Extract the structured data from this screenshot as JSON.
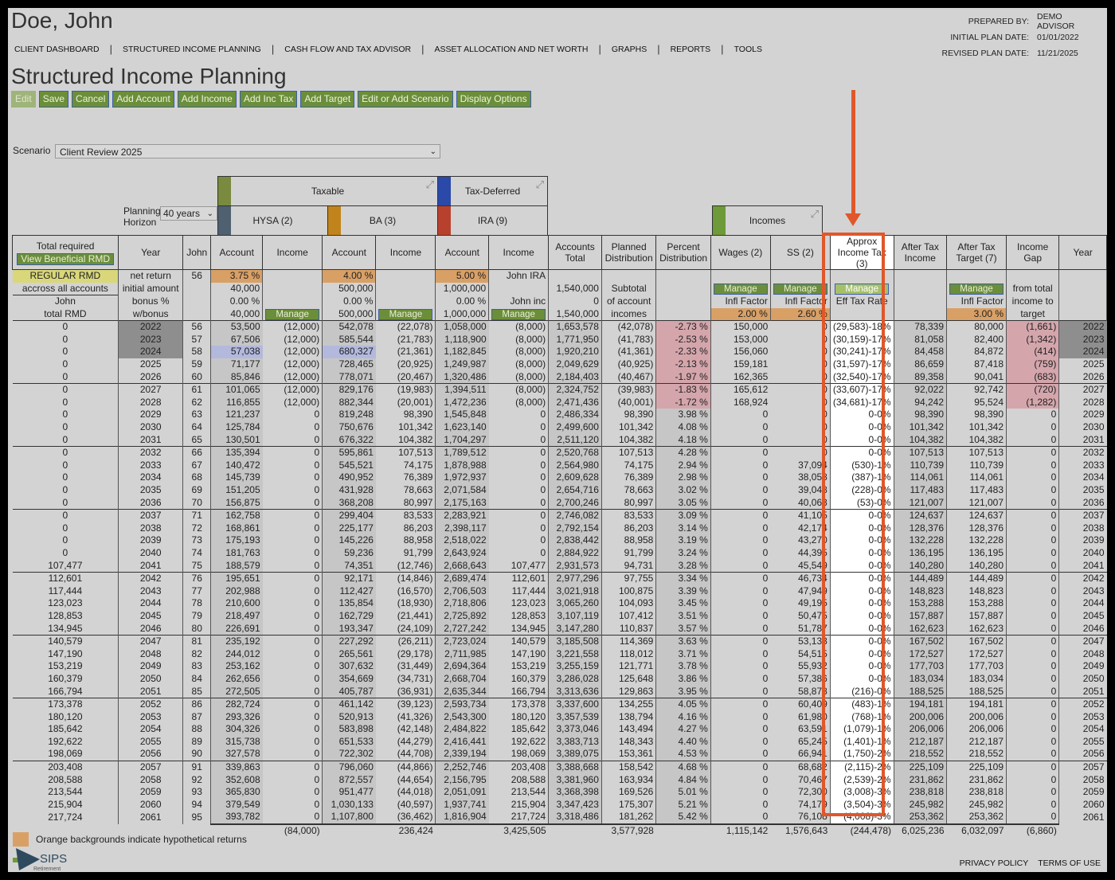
{
  "client_name": "Doe, John",
  "nav": [
    "CLIENT DASHBOARD",
    "STRUCTURED INCOME PLANNING",
    "CASH FLOW AND TAX ADVISOR",
    "ASSET ALLOCATION AND NET WORTH",
    "GRAPHS",
    "REPORTS",
    "TOOLS"
  ],
  "plan_info": {
    "prepared_by_label": "PREPARED BY:",
    "prepared_by": "DEMO ADVISOR",
    "initial_label": "INITIAL PLAN DATE:",
    "initial": "01/01/2022",
    "revised_label": "REVISED PLAN DATE:",
    "revised": "11/21/2025"
  },
  "page_title": "Structured Income Planning",
  "toolbar": [
    "Edit",
    "Save",
    "Cancel",
    "Add Account",
    "Add Income",
    "Add Inc Tax",
    "Add Target",
    "Edit or Add Scenario",
    "Display Options"
  ],
  "scenario": {
    "label": "Scenario",
    "value": "Client Review 2025"
  },
  "planning_horizon": {
    "label": "Planning Horizon",
    "value": "40 years"
  },
  "groups": {
    "taxable": "Taxable",
    "tax_deferred": "Tax-Deferred",
    "hysa": "HYSA (2)",
    "ba": "BA (3)",
    "ira": "IRA (9)",
    "incomes": "Incomes"
  },
  "colors": {
    "taxable": "#7a8a3e",
    "tax_deferred": "#2a49a8",
    "hysa": "#4f6070",
    "ba": "#c1841c",
    "ira": "#b8412e",
    "incomes": "#6e9a3a",
    "hypothetical": "#d9a066",
    "highlight": "#e0572a"
  },
  "table": {
    "total_required": "Total required",
    "view_rmd_button": "View Beneficial RMD",
    "columns": [
      "",
      "Year",
      "John",
      "Account",
      "Income",
      "Account",
      "Income",
      "Account",
      "Income",
      "Accounts Total",
      "Planned Distribution",
      "Percent Distribution",
      "Wages (2)",
      "SS (2)",
      "Approx Income Tax (3)",
      "After Tax Income",
      "After Tax Target (7)",
      "Income Gap",
      "Year"
    ],
    "sub_rows": [
      [
        "REGULAR RMD",
        "net return",
        "56",
        "3.75 %",
        "",
        "4.00 %",
        "",
        "5.00 %",
        "John IRA",
        "",
        "",
        "",
        "",
        "",
        "",
        "",
        "",
        "",
        ""
      ],
      [
        "accross all accounts",
        "initial amount",
        "",
        "40,000",
        "",
        "500,000",
        "",
        "1,000,000",
        "",
        "1,540,000",
        "Subtotal",
        "",
        {
          "button": "Manage"
        },
        {
          "button": "Manage"
        },
        {
          "button": "Manage"
        },
        "",
        {
          "button": "Manage"
        },
        "from total",
        ""
      ],
      [
        "John",
        "bonus %",
        "",
        "0.00 %",
        "",
        "0.00 %",
        "",
        "0.00 %",
        "John inc",
        "0",
        "of account",
        "",
        "Infl Factor",
        "Infl Factor",
        "Eff Tax Rate",
        "",
        "Infl Factor",
        "income to",
        ""
      ],
      [
        "total RMD",
        "w/bonus",
        "",
        "40,000",
        {
          "button": "Manage"
        },
        "500,000",
        {
          "button": "Manage"
        },
        "1,000,000",
        {
          "button": "Manage"
        },
        "1,540,000",
        "incomes",
        "",
        "2.00 %",
        "2.60 %",
        "",
        "",
        "3.00 %",
        "target",
        ""
      ]
    ],
    "rows": [
      [
        "0",
        "2022",
        "56",
        "53,500",
        "(12,000)",
        "542,078",
        "(22,078)",
        "1,058,000",
        "(8,000)",
        "1,653,578",
        "(42,078)",
        "-2.73 %",
        "150,000",
        "0",
        "(29,583)-18%",
        "78,339",
        "80,000",
        "(1,661)",
        "2022"
      ],
      [
        "0",
        "2023",
        "57",
        "67,506",
        "(12,000)",
        "585,544",
        "(21,783)",
        "1,118,900",
        "(8,000)",
        "1,771,950",
        "(41,783)",
        "-2.53 %",
        "153,000",
        "0",
        "(30,159)-17%",
        "81,058",
        "82,400",
        "(1,342)",
        "2023"
      ],
      [
        "0",
        "2024",
        "58",
        "57,038",
        "(12,000)",
        "680,327",
        "(21,361)",
        "1,182,845",
        "(8,000)",
        "1,920,210",
        "(41,361)",
        "-2.33 %",
        "156,060",
        "0",
        "(30,241)-17%",
        "84,458",
        "84,872",
        "(414)",
        "2024"
      ],
      [
        "0",
        "2025",
        "59",
        "71,177",
        "(12,000)",
        "728,465",
        "(20,925)",
        "1,249,987",
        "(8,000)",
        "2,049,629",
        "(40,925)",
        "-2.13 %",
        "159,181",
        "0",
        "(31,597)-17%",
        "86,659",
        "87,418",
        "(759)",
        "2025"
      ],
      [
        "0",
        "2026",
        "60",
        "85,846",
        "(12,000)",
        "778,071",
        "(20,467)",
        "1,320,486",
        "(8,000)",
        "2,184,403",
        "(40,467)",
        "-1.97 %",
        "162,365",
        "0",
        "(32,540)-17%",
        "89,358",
        "90,041",
        "(683)",
        "2026"
      ],
      [
        "0",
        "2027",
        "61",
        "101,065",
        "(12,000)",
        "829,176",
        "(19,983)",
        "1,394,511",
        "(8,000)",
        "2,324,752",
        "(39,983)",
        "-1.83 %",
        "165,612",
        "0",
        "(33,607)-17%",
        "92,022",
        "92,742",
        "(720)",
        "2027"
      ],
      [
        "0",
        "2028",
        "62",
        "116,855",
        "(12,000)",
        "882,344",
        "(20,001)",
        "1,472,236",
        "(8,000)",
        "2,471,436",
        "(40,001)",
        "-1.72 %",
        "168,924",
        "0",
        "(34,681)-17%",
        "94,242",
        "95,524",
        "(1,282)",
        "2028"
      ],
      [
        "0",
        "2029",
        "63",
        "121,237",
        "0",
        "819,248",
        "98,390",
        "1,545,848",
        "0",
        "2,486,334",
        "98,390",
        "3.98 %",
        "0",
        "0",
        "0-0%",
        "98,390",
        "98,390",
        "0",
        "2029"
      ],
      [
        "0",
        "2030",
        "64",
        "125,784",
        "0",
        "750,676",
        "101,342",
        "1,623,140",
        "0",
        "2,499,600",
        "101,342",
        "4.08 %",
        "0",
        "0",
        "0-0%",
        "101,342",
        "101,342",
        "0",
        "2030"
      ],
      [
        "0",
        "2031",
        "65",
        "130,501",
        "0",
        "676,322",
        "104,382",
        "1,704,297",
        "0",
        "2,511,120",
        "104,382",
        "4.18 %",
        "0",
        "0",
        "0-0%",
        "104,382",
        "104,382",
        "0",
        "2031"
      ],
      [
        "0",
        "2032",
        "66",
        "135,394",
        "0",
        "595,861",
        "107,513",
        "1,789,512",
        "0",
        "2,520,768",
        "107,513",
        "4.28 %",
        "0",
        "0",
        "0-0%",
        "107,513",
        "107,513",
        "0",
        "2032"
      ],
      [
        "0",
        "2033",
        "67",
        "140,472",
        "0",
        "545,521",
        "74,175",
        "1,878,988",
        "0",
        "2,564,980",
        "74,175",
        "2.94 %",
        "0",
        "37,094",
        "(530)-1%",
        "110,739",
        "110,739",
        "0",
        "2033"
      ],
      [
        "0",
        "2034",
        "68",
        "145,739",
        "0",
        "490,952",
        "76,389",
        "1,972,937",
        "0",
        "2,609,628",
        "76,389",
        "2.98 %",
        "0",
        "38,058",
        "(387)-1%",
        "114,061",
        "114,061",
        "0",
        "2034"
      ],
      [
        "0",
        "2035",
        "69",
        "151,205",
        "0",
        "431,928",
        "78,663",
        "2,071,584",
        "0",
        "2,654,716",
        "78,663",
        "3.02 %",
        "0",
        "39,048",
        "(228)-0%",
        "117,483",
        "117,483",
        "0",
        "2035"
      ],
      [
        "0",
        "2036",
        "70",
        "156,875",
        "0",
        "368,208",
        "80,997",
        "2,175,163",
        "0",
        "2,700,246",
        "80,997",
        "3.05 %",
        "0",
        "40,063",
        "(53)-0%",
        "121,007",
        "121,007",
        "0",
        "2036"
      ],
      [
        "0",
        "2037",
        "71",
        "162,758",
        "0",
        "299,404",
        "83,533",
        "2,283,921",
        "0",
        "2,746,082",
        "83,533",
        "3.09 %",
        "0",
        "41,105",
        "0-0%",
        "124,637",
        "124,637",
        "0",
        "2037"
      ],
      [
        "0",
        "2038",
        "72",
        "168,861",
        "0",
        "225,177",
        "86,203",
        "2,398,117",
        "0",
        "2,792,154",
        "86,203",
        "3.14 %",
        "0",
        "42,174",
        "0-0%",
        "128,376",
        "128,376",
        "0",
        "2038"
      ],
      [
        "0",
        "2039",
        "73",
        "175,193",
        "0",
        "145,226",
        "88,958",
        "2,518,022",
        "0",
        "2,838,442",
        "88,958",
        "3.19 %",
        "0",
        "43,270",
        "0-0%",
        "132,228",
        "132,228",
        "0",
        "2039"
      ],
      [
        "0",
        "2040",
        "74",
        "181,763",
        "0",
        "59,236",
        "91,799",
        "2,643,924",
        "0",
        "2,884,922",
        "91,799",
        "3.24 %",
        "0",
        "44,395",
        "0-0%",
        "136,195",
        "136,195",
        "0",
        "2040"
      ],
      [
        "107,477",
        "2041",
        "75",
        "188,579",
        "0",
        "74,351",
        "(12,746)",
        "2,668,643",
        "107,477",
        "2,931,573",
        "94,731",
        "3.28 %",
        "0",
        "45,549",
        "0-0%",
        "140,280",
        "140,280",
        "0",
        "2041"
      ],
      [
        "112,601",
        "2042",
        "76",
        "195,651",
        "0",
        "92,171",
        "(14,846)",
        "2,689,474",
        "112,601",
        "2,977,296",
        "97,755",
        "3.34 %",
        "0",
        "46,734",
        "0-0%",
        "144,489",
        "144,489",
        "0",
        "2042"
      ],
      [
        "117,444",
        "2043",
        "77",
        "202,988",
        "0",
        "112,427",
        "(16,570)",
        "2,706,503",
        "117,444",
        "3,021,918",
        "100,875",
        "3.39 %",
        "0",
        "47,949",
        "0-0%",
        "148,823",
        "148,823",
        "0",
        "2043"
      ],
      [
        "123,023",
        "2044",
        "78",
        "210,600",
        "0",
        "135,854",
        "(18,930)",
        "2,718,806",
        "123,023",
        "3,065,260",
        "104,093",
        "3.45 %",
        "0",
        "49,195",
        "0-0%",
        "153,288",
        "153,288",
        "0",
        "2044"
      ],
      [
        "128,853",
        "2045",
        "79",
        "218,497",
        "0",
        "162,729",
        "(21,441)",
        "2,725,892",
        "128,853",
        "3,107,119",
        "107,412",
        "3.51 %",
        "0",
        "50,475",
        "0-0%",
        "157,887",
        "157,887",
        "0",
        "2045"
      ],
      [
        "134,945",
        "2046",
        "80",
        "226,691",
        "0",
        "193,347",
        "(24,109)",
        "2,727,242",
        "134,945",
        "3,147,280",
        "110,837",
        "3.57 %",
        "0",
        "51,787",
        "0-0%",
        "162,623",
        "162,623",
        "0",
        "2046"
      ],
      [
        "140,579",
        "2047",
        "81",
        "235,192",
        "0",
        "227,292",
        "(26,211)",
        "2,723,024",
        "140,579",
        "3,185,508",
        "114,369",
        "3.63 %",
        "0",
        "53,133",
        "0-0%",
        "167,502",
        "167,502",
        "0",
        "2047"
      ],
      [
        "147,190",
        "2048",
        "82",
        "244,012",
        "0",
        "265,561",
        "(29,178)",
        "2,711,985",
        "147,190",
        "3,221,558",
        "118,012",
        "3.71 %",
        "0",
        "54,515",
        "0-0%",
        "172,527",
        "172,527",
        "0",
        "2048"
      ],
      [
        "153,219",
        "2049",
        "83",
        "253,162",
        "0",
        "307,632",
        "(31,449)",
        "2,694,364",
        "153,219",
        "3,255,159",
        "121,771",
        "3.78 %",
        "0",
        "55,932",
        "0-0%",
        "177,703",
        "177,703",
        "0",
        "2049"
      ],
      [
        "160,379",
        "2050",
        "84",
        "262,656",
        "0",
        "354,669",
        "(34,731)",
        "2,668,704",
        "160,379",
        "3,286,028",
        "125,648",
        "3.86 %",
        "0",
        "57,386",
        "0-0%",
        "183,034",
        "183,034",
        "0",
        "2050"
      ],
      [
        "166,794",
        "2051",
        "85",
        "272,505",
        "0",
        "405,787",
        "(36,931)",
        "2,635,344",
        "166,794",
        "3,313,636",
        "129,863",
        "3.95 %",
        "0",
        "58,878",
        "(216)-0%",
        "188,525",
        "188,525",
        "0",
        "2051"
      ],
      [
        "173,378",
        "2052",
        "86",
        "282,724",
        "0",
        "461,142",
        "(39,123)",
        "2,593,734",
        "173,378",
        "3,337,600",
        "134,255",
        "4.05 %",
        "0",
        "60,409",
        "(483)-1%",
        "194,181",
        "194,181",
        "0",
        "2052"
      ],
      [
        "180,120",
        "2053",
        "87",
        "293,326",
        "0",
        "520,913",
        "(41,326)",
        "2,543,300",
        "180,120",
        "3,357,539",
        "138,794",
        "4.16 %",
        "0",
        "61,980",
        "(768)-1%",
        "200,006",
        "200,006",
        "0",
        "2053"
      ],
      [
        "185,642",
        "2054",
        "88",
        "304,326",
        "0",
        "583,898",
        "(42,148)",
        "2,484,822",
        "185,642",
        "3,373,046",
        "143,494",
        "4.27 %",
        "0",
        "63,591",
        "(1,079)-1%",
        "206,006",
        "206,006",
        "0",
        "2054"
      ],
      [
        "192,622",
        "2055",
        "89",
        "315,738",
        "0",
        "651,533",
        "(44,279)",
        "2,416,441",
        "192,622",
        "3,383,713",
        "148,343",
        "4.40 %",
        "0",
        "65,245",
        "(1,401)-1%",
        "212,187",
        "212,187",
        "0",
        "2055"
      ],
      [
        "198,069",
        "2056",
        "90",
        "327,578",
        "0",
        "722,302",
        "(44,708)",
        "2,339,194",
        "198,069",
        "3,389,075",
        "153,361",
        "4.53 %",
        "0",
        "66,941",
        "(1,750)-2%",
        "218,552",
        "218,552",
        "0",
        "2056"
      ],
      [
        "203,408",
        "2057",
        "91",
        "339,863",
        "0",
        "796,060",
        "(44,866)",
        "2,252,746",
        "203,408",
        "3,388,668",
        "158,542",
        "4.68 %",
        "0",
        "68,682",
        "(2,115)-2%",
        "225,109",
        "225,109",
        "0",
        "2057"
      ],
      [
        "208,588",
        "2058",
        "92",
        "352,608",
        "0",
        "872,557",
        "(44,654)",
        "2,156,795",
        "208,588",
        "3,381,960",
        "163,934",
        "4.84 %",
        "0",
        "70,467",
        "(2,539)-2%",
        "231,862",
        "231,862",
        "0",
        "2058"
      ],
      [
        "213,544",
        "2059",
        "93",
        "365,830",
        "0",
        "951,477",
        "(44,018)",
        "2,051,091",
        "213,544",
        "3,368,398",
        "169,526",
        "5.01 %",
        "0",
        "72,300",
        "(3,008)-3%",
        "238,818",
        "238,818",
        "0",
        "2059"
      ],
      [
        "215,904",
        "2060",
        "94",
        "379,549",
        "0",
        "1,030,133",
        "(40,597)",
        "1,937,741",
        "215,904",
        "3,347,423",
        "175,307",
        "5.21 %",
        "0",
        "74,179",
        "(3,504)-3%",
        "245,982",
        "245,982",
        "0",
        "2060"
      ],
      [
        "217,724",
        "2061",
        "95",
        "393,782",
        "0",
        "1,107,800",
        "(36,462)",
        "1,816,904",
        "217,724",
        "3,318,486",
        "181,262",
        "5.42 %",
        "0",
        "76,108",
        "(4,008)-3%",
        "253,362",
        "253,362",
        "0",
        "2061"
      ]
    ],
    "totals": [
      "",
      "",
      "",
      "",
      "(84,000)",
      "",
      "236,424",
      "",
      "3,425,505",
      "",
      "3,577,928",
      "",
      "1,115,142",
      "1,576,643",
      "(244,478)",
      "6,025,236",
      "6,032,097",
      "(6,860)",
      ""
    ]
  },
  "legend": "Orange backgrounds indicate hypothetical returns",
  "logo_text": "SIPS Retirement",
  "footer": {
    "privacy": "PRIVACY POLICY",
    "terms": "TERMS OF USE"
  }
}
